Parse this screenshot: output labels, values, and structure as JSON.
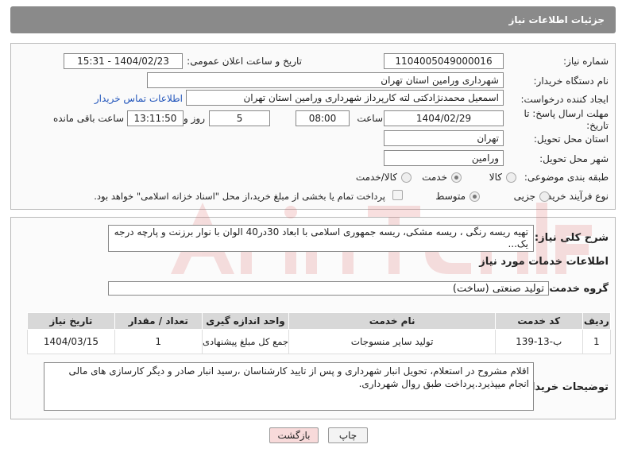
{
  "header_title": "جزئیات اطلاعات نیاز",
  "fields": {
    "need_number_label": "شماره نیاز:",
    "need_number": "1104005049000016",
    "announce_label": "تاریخ و ساعت اعلان عمومی:",
    "announce_value": "1404/02/23 - 15:31",
    "buyer_org_label": "نام دستگاه خریدار:",
    "buyer_org": "شهرداری ورامین استان تهران",
    "creator_label": "ایجاد کننده درخواست:",
    "creator": "اسمعیل محمدنژادکتی لته کارپرداز شهرداری ورامین استان تهران",
    "contact_link": "اطلاعات تماس خریدار",
    "deadline_label": "مهلت ارسال پاسخ: تا تاریخ:",
    "deadline_date": "1404/02/29",
    "time_label": "ساعت",
    "deadline_time": "08:00",
    "days_value": "5",
    "days_label": "روز و",
    "remaining_time": "13:11:50",
    "remaining_label": "ساعت باقی مانده",
    "province_label": "استان محل تحویل:",
    "province": "تهران",
    "city_label": "شهر محل تحویل:",
    "city": "ورامین",
    "category_label": "طبقه بندی موضوعی:",
    "category_options": [
      "کالا",
      "خدمت",
      "کالا/خدمت"
    ],
    "category_selected": "خدمت",
    "process_label": "نوع فرآیند خرید :",
    "process_options": [
      "جزیی",
      "متوسط"
    ],
    "process_selected": "جزیی",
    "payment_note": "پرداخت تمام یا بخشی از مبلغ خرید،از محل \"اسناد خزانه اسلامی\" خواهد بود."
  },
  "summary_label": "شرح کلی نیاز:",
  "summary_text": "تهیه ریسه رنگی ، ریسه مشکی، ریسه جمهوری اسلامی با ابعاد 30در40 الوان با نوار برزنت و پارچه درجه یک...",
  "services_title": "اطلاعات خدمات مورد نیاز",
  "service_group_label": "گروه خدمت:",
  "service_group": "تولید صنعتی (ساخت)",
  "table": {
    "headers": [
      "ردیف",
      "کد خدمت",
      "نام خدمت",
      "واحد اندازه گیری",
      "تعداد / مقدار",
      "تاریخ نیاز"
    ],
    "rows": [
      [
        "1",
        "ب-13-139",
        "تولید سایر منسوجات",
        "جمع کل مبلغ پیشنهادی",
        "1",
        "1404/03/15"
      ]
    ]
  },
  "buyer_notes_label": "توضیحات خریدار:",
  "buyer_notes": "اقلام مشروح در استعلام، تحویل انبار شهرداری و پس از تایید کارشناسان ،رسید انبار صادر و دیگر کارسازی های مالی انجام میپذیرد.پرداخت طبق روال شهرداری.",
  "buttons": {
    "print": "چاپ",
    "back": "بازگشت"
  },
  "colors": {
    "header_bg": "#8a8a8a",
    "link": "#2255bb",
    "back_button_bg": "#f8dada",
    "watermark": "#e07070"
  }
}
